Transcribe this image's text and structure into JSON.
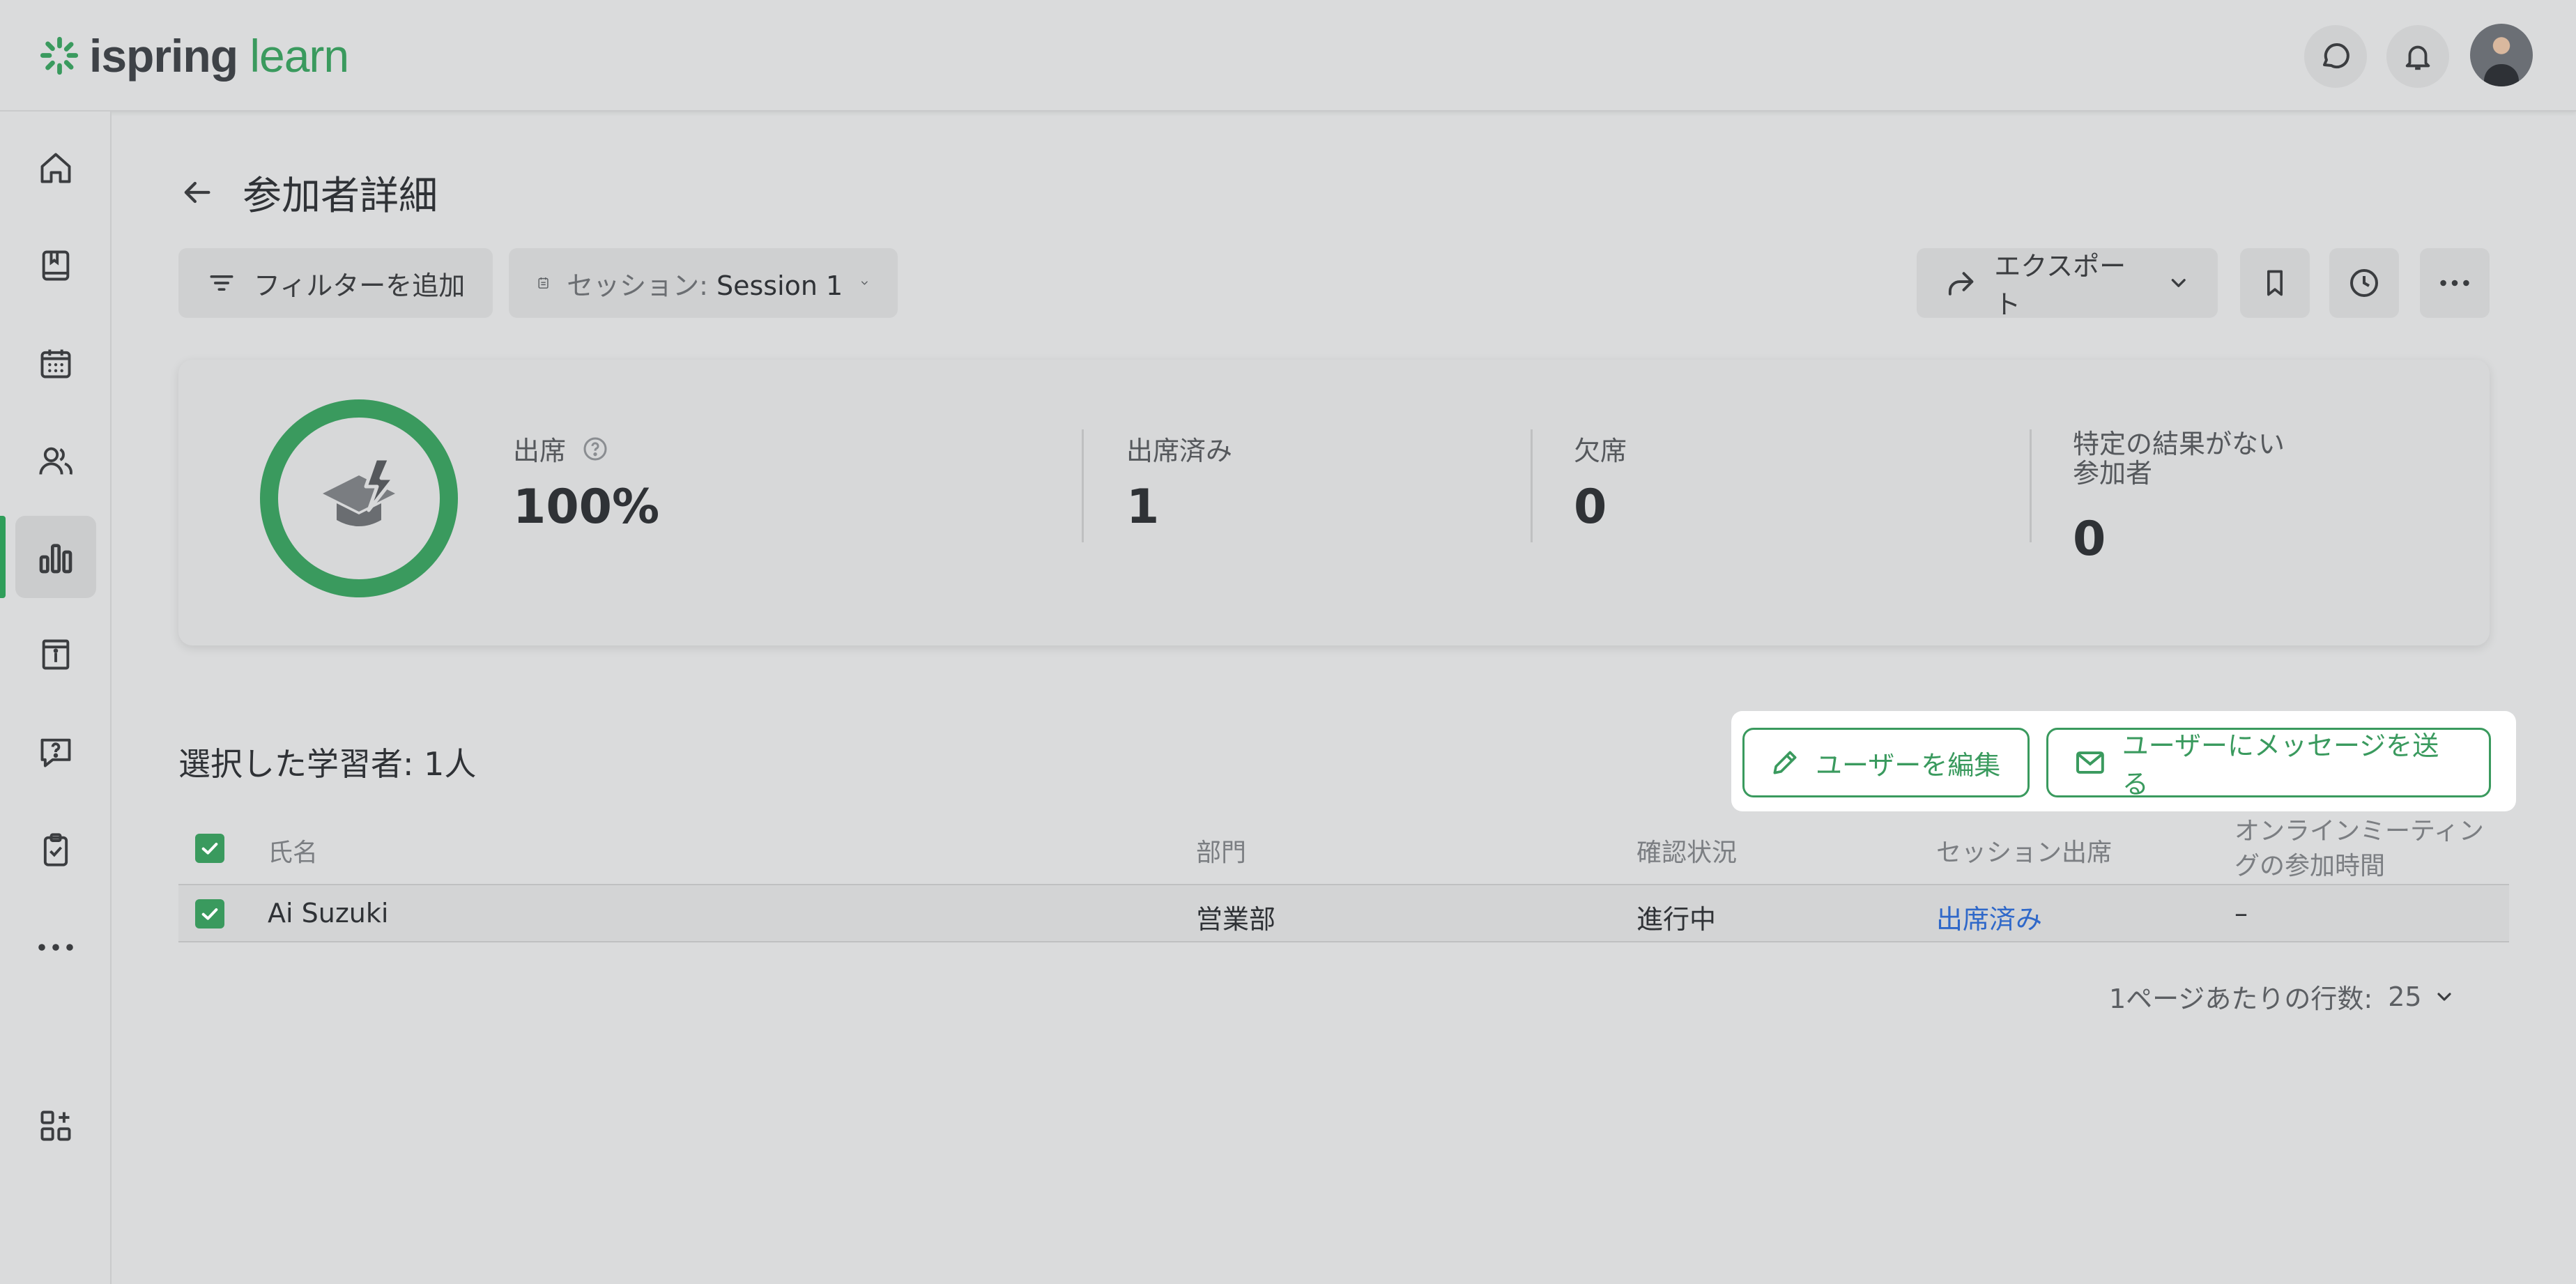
{
  "app": {
    "logo_word1": "ispring",
    "logo_word2": "learn",
    "brand_color": "#3a9a5e",
    "link_color": "#2f68c9"
  },
  "header": {
    "icons": [
      "chat-icon",
      "bell-icon"
    ]
  },
  "sidebar": {
    "items": [
      {
        "name": "home",
        "icon": "home-icon",
        "active": false
      },
      {
        "name": "library",
        "icon": "book-icon",
        "active": false
      },
      {
        "name": "calendar",
        "icon": "calendar-icon",
        "active": false
      },
      {
        "name": "users",
        "icon": "users-icon",
        "active": false
      },
      {
        "name": "reports",
        "icon": "bar-chart-icon",
        "active": true
      },
      {
        "name": "info",
        "icon": "info-book-icon",
        "active": false
      },
      {
        "name": "questions",
        "icon": "question-icon",
        "active": false
      },
      {
        "name": "tasks",
        "icon": "clipboard-check-icon",
        "active": false
      },
      {
        "name": "more",
        "icon": "more-dots-icon",
        "active": false
      },
      {
        "name": "add-widget",
        "icon": "add-grid-icon",
        "active": false
      }
    ]
  },
  "page": {
    "title": "参加者詳細"
  },
  "toolbar": {
    "filter_label": "フィルターを追加",
    "session_prefix": "セッション: ",
    "session_value": "Session 1",
    "export_label": "エクスポート"
  },
  "stats": {
    "attendance_label": "出席",
    "attendance_value": "100%",
    "attendance_fraction": 1.0,
    "attended_label": "出席済み",
    "attended_value": "1",
    "absent_label": "欠席",
    "absent_value": "0",
    "no_result_label_line1": "特定の結果がない",
    "no_result_label_line2": "参加者",
    "no_result_value": "0"
  },
  "selection": {
    "label": "選択した学習者: 1人",
    "edit_user_label": "ユーザーを編集",
    "message_user_label": "ユーザーにメッセージを送る"
  },
  "table": {
    "headers": {
      "name": "氏名",
      "department": "部門",
      "confirmation": "確認状況",
      "session_attendance": "セッション出席",
      "online_time_line1": "オンラインミーティン",
      "online_time_line2": "グの参加時間"
    },
    "rows": [
      {
        "name": "Ai Suzuki",
        "department": "営業部",
        "confirmation": "進行中",
        "session_attendance": "出席済み",
        "online_time": "–"
      }
    ]
  },
  "pagination": {
    "rows_per_page_label": "1ページあたりの行数:",
    "rows_per_page_value": "25"
  }
}
